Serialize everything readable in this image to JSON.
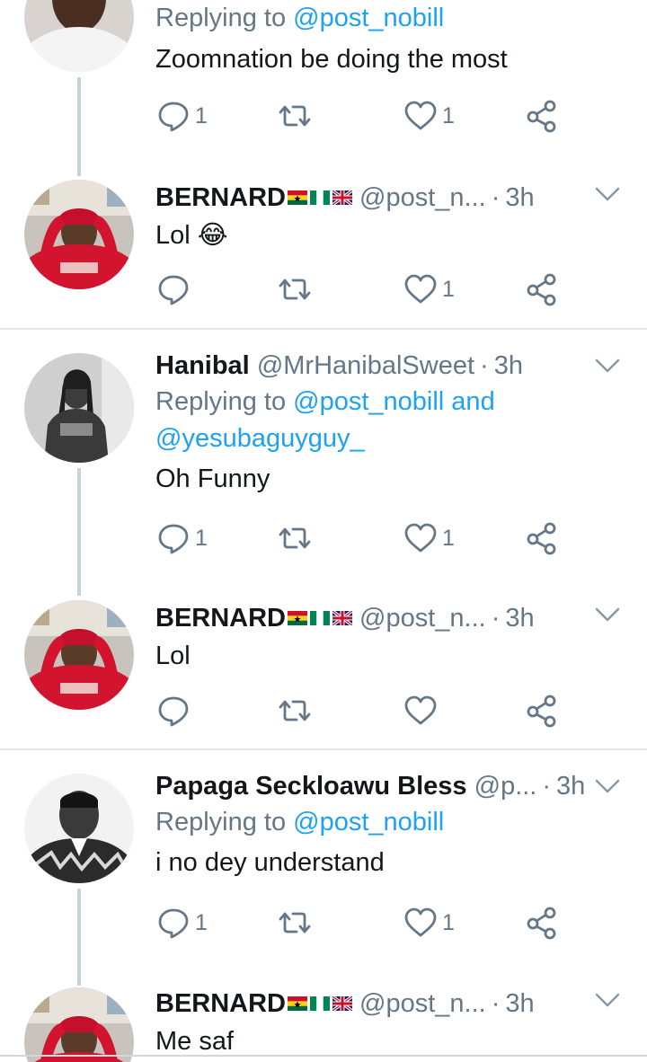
{
  "tweets": [
    {
      "reply_to_label": "Replying to",
      "reply_to_mentions": "@post_nobill",
      "text": "Zoomnation be doing the most",
      "counts": {
        "reply": "1",
        "retweet": "",
        "like": "1"
      }
    },
    {
      "name": "BERNARD",
      "flags": [
        "ghana",
        "nigeria",
        "uk"
      ],
      "handle": "@post_n...",
      "time": "3h",
      "text": "Lol 😂",
      "counts": {
        "reply": "",
        "retweet": "",
        "like": "1"
      }
    },
    {
      "name": "Hanibal",
      "handle": "@MrHanibalSweet",
      "time": "3h",
      "reply_to_label": "Replying to",
      "reply_to_mentions": "@post_nobill and @yesubaguyguy_",
      "text": "Oh Funny",
      "counts": {
        "reply": "1",
        "retweet": "",
        "like": "1"
      }
    },
    {
      "name": "BERNARD",
      "flags": [
        "ghana",
        "nigeria",
        "uk"
      ],
      "handle": "@post_n...",
      "time": "3h",
      "text": "Lol",
      "counts": {
        "reply": "",
        "retweet": "",
        "like": ""
      }
    },
    {
      "name": "Papaga Seckloawu Bless",
      "handle": "@p...",
      "time": "3h",
      "reply_to_label": "Replying to",
      "reply_to_mentions": "@post_nobill",
      "text": "i no dey understand",
      "counts": {
        "reply": "1",
        "retweet": "",
        "like": "1"
      }
    },
    {
      "name": "BERNARD",
      "flags": [
        "ghana",
        "nigeria",
        "uk"
      ],
      "handle": "@post_n...",
      "time": "3h",
      "text": "Me saf"
    }
  ],
  "icons": {
    "reply": "reply-icon",
    "retweet": "retweet-icon",
    "like": "heart-icon",
    "share": "share-icon",
    "more": "chevron-down-icon"
  },
  "colors": {
    "link": "#1da1f2",
    "muted": "#657786",
    "thread_line": "#c7d2d9",
    "divider": "#e1e8ed"
  }
}
